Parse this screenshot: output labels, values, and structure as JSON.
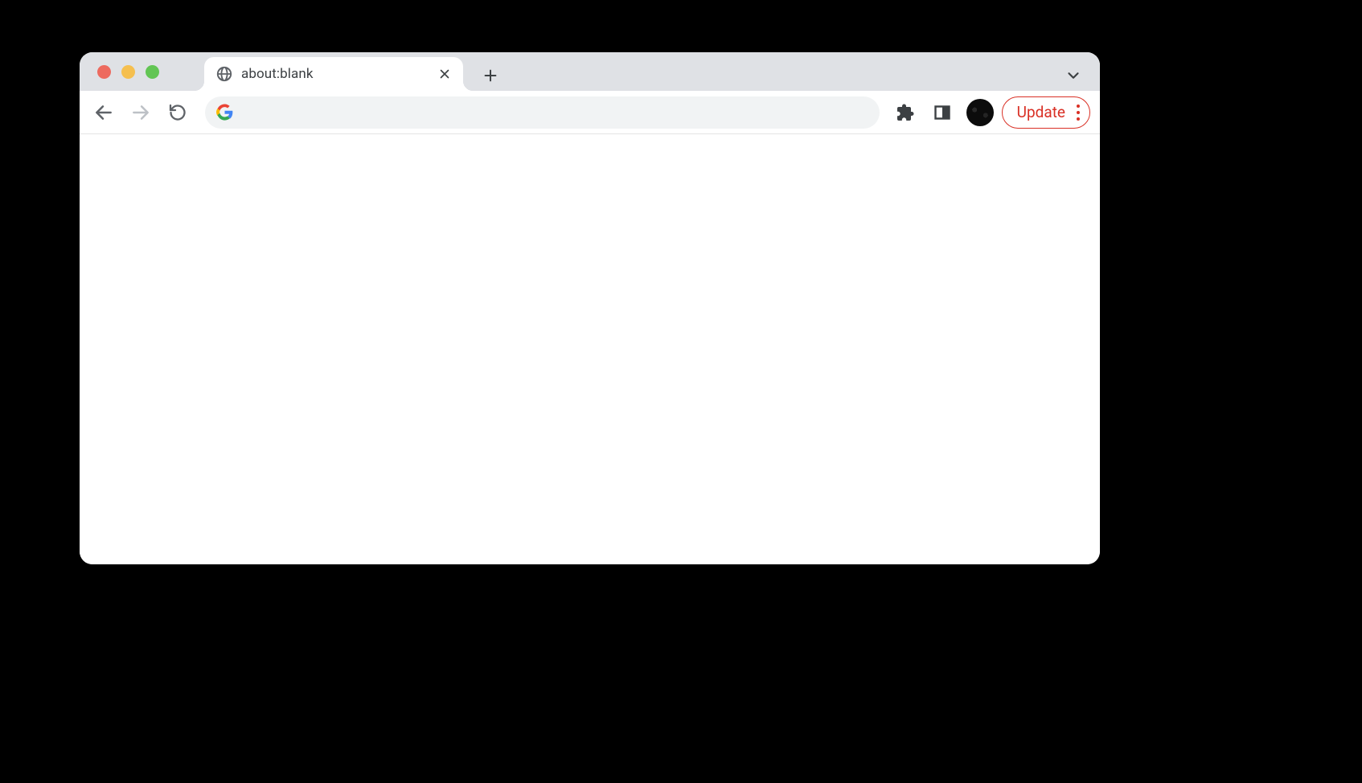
{
  "tab": {
    "title": "about:blank",
    "favicon": "globe-icon"
  },
  "toolbar": {
    "address_value": "",
    "address_placeholder": "",
    "update_label": "Update"
  },
  "colors": {
    "tab_strip_bg": "#dfe1e5",
    "update_red": "#d93025"
  }
}
